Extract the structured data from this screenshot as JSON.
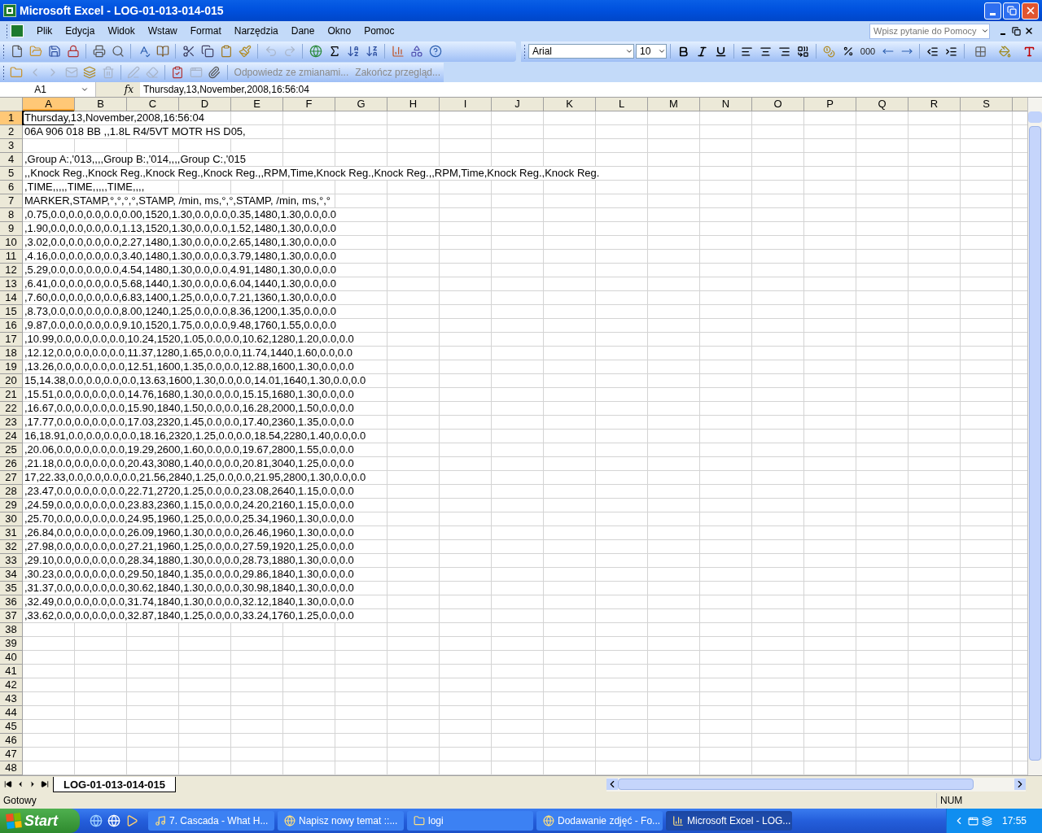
{
  "window": {
    "title": "Microsoft Excel - LOG-01-013-014-015"
  },
  "menu": [
    {
      "label": "Plik"
    },
    {
      "label": "Edycja"
    },
    {
      "label": "Widok"
    },
    {
      "label": "Wstaw"
    },
    {
      "label": "Format"
    },
    {
      "label": "Narzędzia"
    },
    {
      "label": "Dane"
    },
    {
      "label": "Okno"
    },
    {
      "label": "Pomoc"
    }
  ],
  "help_search": {
    "placeholder": "Wpisz pytanie do Pomocy"
  },
  "standard_toolbar": [
    [
      {
        "kind": "new",
        "disabled": false
      },
      {
        "kind": "open",
        "disabled": false
      },
      {
        "kind": "save",
        "disabled": false
      },
      {
        "kind": "permission",
        "disabled": false
      }
    ],
    [
      {
        "kind": "print",
        "disabled": false
      },
      {
        "kind": "preview",
        "disabled": false
      }
    ],
    [
      {
        "kind": "spelling",
        "disabled": false
      },
      {
        "kind": "research",
        "disabled": false
      }
    ],
    [
      {
        "kind": "cut",
        "disabled": false
      },
      {
        "kind": "copy",
        "disabled": false
      },
      {
        "kind": "paste",
        "disabled": false
      },
      {
        "kind": "brush",
        "disabled": false
      }
    ],
    [
      {
        "kind": "undo",
        "disabled": true
      },
      {
        "kind": "redo",
        "disabled": true
      }
    ],
    [
      {
        "kind": "link",
        "disabled": false
      },
      {
        "kind": "sum",
        "disabled": false
      },
      {
        "kind": "sortaz",
        "disabled": false
      },
      {
        "kind": "sortza",
        "disabled": false
      }
    ],
    [
      {
        "kind": "chart",
        "disabled": false
      },
      {
        "kind": "drawing",
        "disabled": false
      },
      {
        "kind": "help",
        "disabled": false
      }
    ]
  ],
  "format_toolbar": {
    "font": "Arial",
    "size": "10",
    "comma_label": "000"
  },
  "review_toolbar": {
    "buttons": [
      [
        {
          "kind": "folder",
          "disabled": false
        },
        {
          "kind": "prev",
          "disabled": true
        },
        {
          "kind": "next",
          "disabled": true
        },
        {
          "kind": "mail",
          "disabled": true
        },
        {
          "kind": "layers",
          "disabled": false
        },
        {
          "kind": "delete",
          "disabled": true
        }
      ],
      [
        {
          "kind": "ink",
          "disabled": true
        },
        {
          "kind": "erase",
          "disabled": true
        }
      ],
      [
        {
          "kind": "track",
          "disabled": false
        },
        {
          "kind": "window",
          "disabled": true
        },
        {
          "kind": "attach",
          "disabled": false
        }
      ]
    ],
    "reply": "Odpowiedz ze zmianami...",
    "end": "Zakończ przegląd..."
  },
  "name_box": "A1",
  "formula_bar": {
    "label": "fx",
    "value": "Thursday,13,November,2008,16:56:04"
  },
  "columns": [
    {
      "label": "A",
      "selected": true
    },
    {
      "label": "B",
      "selected": false
    },
    {
      "label": "C",
      "selected": false
    },
    {
      "label": "D",
      "selected": false
    },
    {
      "label": "E",
      "selected": false
    },
    {
      "label": "F",
      "selected": false
    },
    {
      "label": "G",
      "selected": false
    },
    {
      "label": "H",
      "selected": false
    },
    {
      "label": "I",
      "selected": false
    },
    {
      "label": "J",
      "selected": false
    },
    {
      "label": "K",
      "selected": false
    },
    {
      "label": "L",
      "selected": false
    },
    {
      "label": "M",
      "selected": false
    },
    {
      "label": "N",
      "selected": false
    },
    {
      "label": "O",
      "selected": false
    },
    {
      "label": "P",
      "selected": false
    },
    {
      "label": "Q",
      "selected": false
    },
    {
      "label": "R",
      "selected": false
    },
    {
      "label": "S",
      "selected": false
    }
  ],
  "rows": [
    {
      "number": "1",
      "selected": true,
      "cell_a": "Thursday,13,November,2008,16:56:04"
    },
    {
      "number": "2",
      "selected": false,
      "cell_a": "06A 906 018 BB ,,1.8L R4/5VT MOTR HS D05,"
    },
    {
      "number": "3",
      "selected": false
    },
    {
      "number": "4",
      "selected": false,
      "cell_a": ",Group A:,'013,,,,Group B:,'014,,,,Group C:,'015"
    },
    {
      "number": "5",
      "selected": false,
      "cell_a": ",,Knock Reg.,Knock Reg.,Knock Reg.,Knock Reg.,,RPM,Time,Knock Reg.,Knock Reg.,,RPM,Time,Knock Reg.,Knock Reg."
    },
    {
      "number": "6",
      "selected": false,
      "cell_a": ",TIME,,,,,TIME,,,,,TIME,,,,"
    },
    {
      "number": "7",
      "selected": false,
      "cell_a": "MARKER,STAMP,°,°,°,°,STAMP, /min, ms,°,°,STAMP, /min, ms,°,°"
    },
    {
      "number": "8",
      "selected": false,
      "cell_a": ",0.75,0.0,0.0,0.0,0.0,0.00,1520,1.30,0.0,0.0,0.35,1480,1.30,0.0,0.0"
    },
    {
      "number": "9",
      "selected": false,
      "cell_a": ",1.90,0.0,0.0,0.0,0.0,1.13,1520,1.30,0.0,0.0,1.52,1480,1.30,0.0,0.0"
    },
    {
      "number": "10",
      "selected": false,
      "cell_a": ",3.02,0.0,0.0,0.0,0.0,2.27,1480,1.30,0.0,0.0,2.65,1480,1.30,0.0,0.0"
    },
    {
      "number": "11",
      "selected": false,
      "cell_a": ",4.16,0.0,0.0,0.0,0.0,3.40,1480,1.30,0.0,0.0,3.79,1480,1.30,0.0,0.0"
    },
    {
      "number": "12",
      "selected": false,
      "cell_a": ",5.29,0.0,0.0,0.0,0.0,4.54,1480,1.30,0.0,0.0,4.91,1480,1.30,0.0,0.0"
    },
    {
      "number": "13",
      "selected": false,
      "cell_a": ",6.41,0.0,0.0,0.0,0.0,5.68,1440,1.30,0.0,0.0,6.04,1440,1.30,0.0,0.0"
    },
    {
      "number": "14",
      "selected": false,
      "cell_a": ",7.60,0.0,0.0,0.0,0.0,6.83,1400,1.25,0.0,0.0,7.21,1360,1.30,0.0,0.0"
    },
    {
      "number": "15",
      "selected": false,
      "cell_a": ",8.73,0.0,0.0,0.0,0.0,8.00,1240,1.25,0.0,0.0,8.36,1200,1.35,0.0,0.0"
    },
    {
      "number": "16",
      "selected": false,
      "cell_a": ",9.87,0.0,0.0,0.0,0.0,9.10,1520,1.75,0.0,0.0,9.48,1760,1.55,0.0,0.0"
    },
    {
      "number": "17",
      "selected": false,
      "cell_a": ",10.99,0.0,0.0,0.0,0.0,10.24,1520,1.05,0.0,0.0,10.62,1280,1.20,0.0,0.0"
    },
    {
      "number": "18",
      "selected": false,
      "cell_a": ",12.12,0.0,0.0,0.0,0.0,11.37,1280,1.65,0.0,0.0,11.74,1440,1.60,0.0,0.0"
    },
    {
      "number": "19",
      "selected": false,
      "cell_a": ",13.26,0.0,0.0,0.0,0.0,12.51,1600,1.35,0.0,0.0,12.88,1600,1.30,0.0,0.0"
    },
    {
      "number": "20",
      "selected": false,
      "cell_a": "15,14.38,0.0,0.0,0.0,0.0,13.63,1600,1.30,0.0,0.0,14.01,1640,1.30,0.0,0.0"
    },
    {
      "number": "21",
      "selected": false,
      "cell_a": ",15.51,0.0,0.0,0.0,0.0,14.76,1680,1.30,0.0,0.0,15.15,1680,1.30,0.0,0.0"
    },
    {
      "number": "22",
      "selected": false,
      "cell_a": ",16.67,0.0,0.0,0.0,0.0,15.90,1840,1.50,0.0,0.0,16.28,2000,1.50,0.0,0.0"
    },
    {
      "number": "23",
      "selected": false,
      "cell_a": ",17.77,0.0,0.0,0.0,0.0,17.03,2320,1.45,0.0,0.0,17.40,2360,1.35,0.0,0.0"
    },
    {
      "number": "24",
      "selected": false,
      "cell_a": "16,18.91,0.0,0.0,0.0,0.0,18.16,2320,1.25,0.0,0.0,18.54,2280,1.40,0.0,0.0"
    },
    {
      "number": "25",
      "selected": false,
      "cell_a": ",20.06,0.0,0.0,0.0,0.0,19.29,2600,1.60,0.0,0.0,19.67,2800,1.55,0.0,0.0"
    },
    {
      "number": "26",
      "selected": false,
      "cell_a": ",21.18,0.0,0.0,0.0,0.0,20.43,3080,1.40,0.0,0.0,20.81,3040,1.25,0.0,0.0"
    },
    {
      "number": "27",
      "selected": false,
      "cell_a": "17,22.33,0.0,0.0,0.0,0.0,21.56,2840,1.25,0.0,0.0,21.95,2800,1.30,0.0,0.0"
    },
    {
      "number": "28",
      "selected": false,
      "cell_a": ",23.47,0.0,0.0,0.0,0.0,22.71,2720,1.25,0.0,0.0,23.08,2640,1.15,0.0,0.0"
    },
    {
      "number": "29",
      "selected": false,
      "cell_a": ",24.59,0.0,0.0,0.0,0.0,23.83,2360,1.15,0.0,0.0,24.20,2160,1.15,0.0,0.0"
    },
    {
      "number": "30",
      "selected": false,
      "cell_a": ",25.70,0.0,0.0,0.0,0.0,24.95,1960,1.25,0.0,0.0,25.34,1960,1.30,0.0,0.0"
    },
    {
      "number": "31",
      "selected": false,
      "cell_a": ",26.84,0.0,0.0,0.0,0.0,26.09,1960,1.30,0.0,0.0,26.46,1960,1.30,0.0,0.0"
    },
    {
      "number": "32",
      "selected": false,
      "cell_a": ",27.98,0.0,0.0,0.0,0.0,27.21,1960,1.25,0.0,0.0,27.59,1920,1.25,0.0,0.0"
    },
    {
      "number": "33",
      "selected": false,
      "cell_a": ",29.10,0.0,0.0,0.0,0.0,28.34,1880,1.30,0.0,0.0,28.73,1880,1.30,0.0,0.0"
    },
    {
      "number": "34",
      "selected": false,
      "cell_a": ",30.23,0.0,0.0,0.0,0.0,29.50,1840,1.35,0.0,0.0,29.86,1840,1.30,0.0,0.0"
    },
    {
      "number": "35",
      "selected": false,
      "cell_a": ",31.37,0.0,0.0,0.0,0.0,30.62,1840,1.30,0.0,0.0,30.98,1840,1.30,0.0,0.0"
    },
    {
      "number": "36",
      "selected": false,
      "cell_a": ",32.49,0.0,0.0,0.0,0.0,31.74,1840,1.30,0.0,0.0,32.12,1840,1.30,0.0,0.0"
    },
    {
      "number": "37",
      "selected": false,
      "cell_a": ",33.62,0.0,0.0,0.0,0.0,32.87,1840,1.25,0.0,0.0,33.24,1760,1.25,0.0,0.0"
    },
    {
      "number": "38",
      "selected": false
    },
    {
      "number": "39",
      "selected": false
    },
    {
      "number": "40",
      "selected": false
    },
    {
      "number": "41",
      "selected": false
    },
    {
      "number": "42",
      "selected": false
    },
    {
      "number": "43",
      "selected": false
    },
    {
      "number": "44",
      "selected": false
    },
    {
      "number": "45",
      "selected": false
    },
    {
      "number": "46",
      "selected": false
    },
    {
      "number": "47",
      "selected": false
    },
    {
      "number": "48",
      "selected": false
    }
  ],
  "sheet_tabs": [
    {
      "label": "LOG-01-013-014-015",
      "selected": true
    }
  ],
  "status_bar": {
    "status": "Gotowy",
    "num": "NUM"
  },
  "taskbar": {
    "start": "Start",
    "tasks": [
      {
        "label": "7. Cascada - What H...",
        "kind": "music",
        "selected": false
      },
      {
        "label": "Napisz nowy temat ::...",
        "kind": "browser",
        "selected": false
      },
      {
        "label": "logi",
        "kind": "folder",
        "selected": false
      },
      {
        "label": "Dodawanie zdjęć - Fo...",
        "kind": "browser",
        "selected": false
      },
      {
        "label": "Microsoft Excel - LOG...",
        "kind": "excel",
        "selected": true
      }
    ],
    "clock": "17:55"
  }
}
